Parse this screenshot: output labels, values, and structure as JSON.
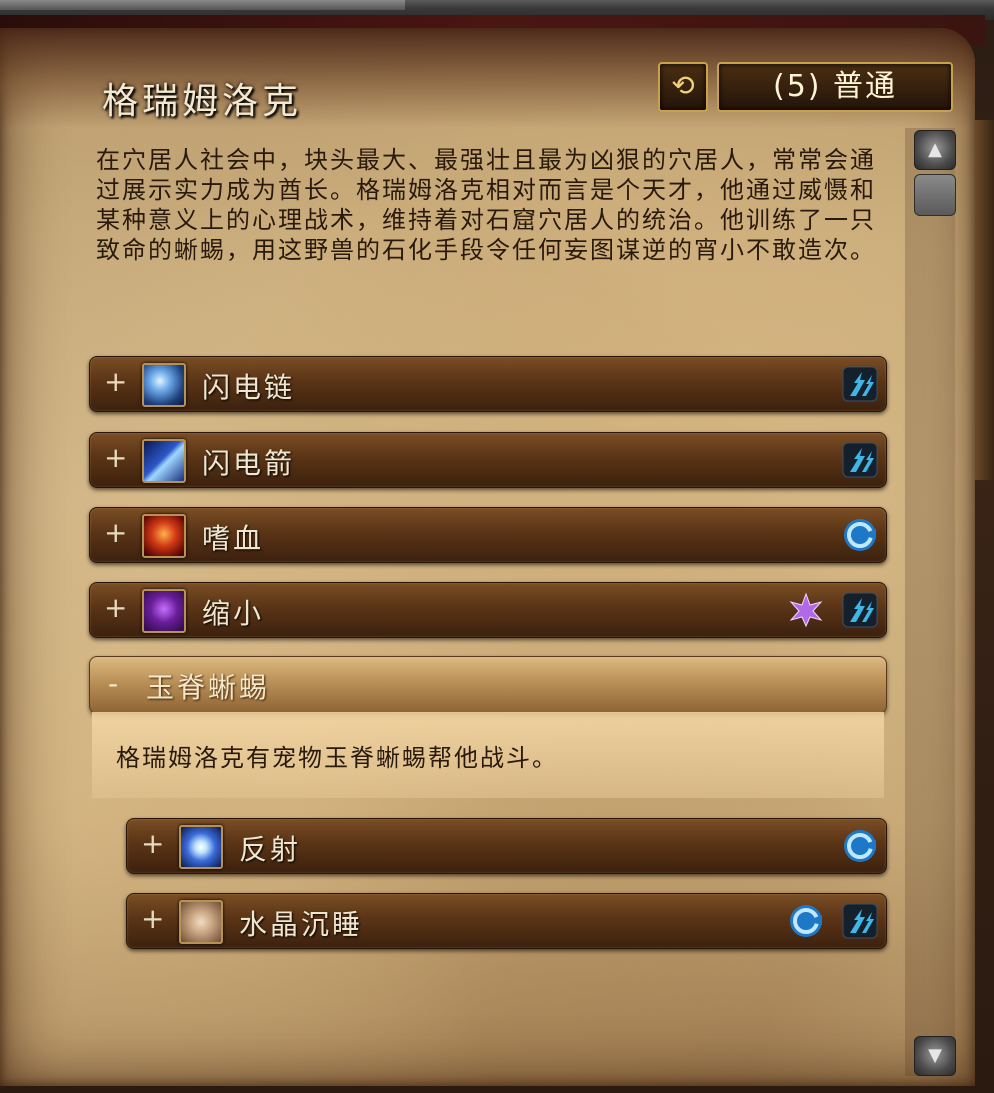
{
  "window": {
    "title": "格瑞姆洛克",
    "reset_icon": "reset-icon",
    "difficulty_label": "(5) 普通"
  },
  "description": "在穴居人社会中，块头最大、最强壮且最为凶狠的穴居人，常常会通过展示实力成为酋长。格瑞姆洛克相对而言是个天才，他通过威慑和某种意义上的心理战术，维持着对石窟穴居人的统治。他训练了一只致命的蜥蜴，用这野兽的石化手段令任何妄图谋逆的宵小不敢造次。",
  "abilities": [
    {
      "toggle": "+",
      "name": "闪电链",
      "icon": "chain-lightning-icon",
      "flags": [
        "magic-dispel"
      ]
    },
    {
      "toggle": "+",
      "name": "闪电箭",
      "icon": "lightning-bolt-icon",
      "flags": [
        "magic-dispel"
      ]
    },
    {
      "toggle": "+",
      "name": "嗜血",
      "icon": "bloodlust-icon",
      "flags": [
        "interruptible"
      ]
    },
    {
      "toggle": "+",
      "name": "缩小",
      "icon": "shrink-icon",
      "flags": [
        "deadly",
        "magic-dispel"
      ]
    }
  ],
  "expanded": {
    "toggle": "-",
    "name": "玉脊蜥蜴",
    "body": "格瑞姆洛克有宠物玉脊蜥蜴帮他战斗。",
    "children": [
      {
        "toggle": "+",
        "name": "反射",
        "icon": "reflect-icon",
        "flags": [
          "interruptible"
        ]
      },
      {
        "toggle": "+",
        "name": "水晶沉睡",
        "icon": "crystal-slumber-icon",
        "flags": [
          "interruptible",
          "magic-dispel"
        ]
      }
    ]
  },
  "scrollbar": {
    "up_icon": "scroll-up-icon",
    "down_icon": "scroll-down-icon"
  },
  "colors": {
    "header_gold": "#c9a14a",
    "row_brown": "#5a3416",
    "parchment": "#cdb184",
    "magic_blue": "#3fb6e6",
    "deadly_purple": "#b069e8"
  }
}
